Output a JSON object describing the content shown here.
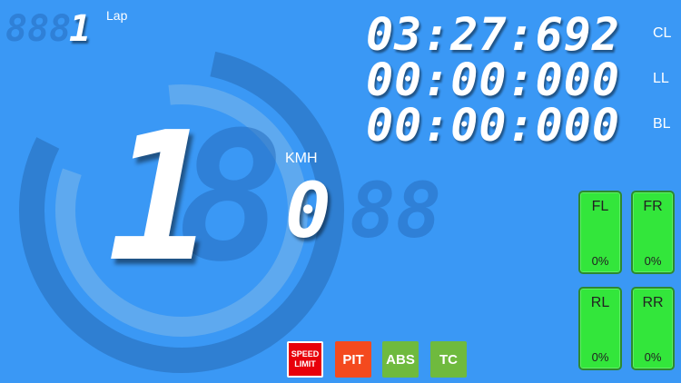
{
  "colors": {
    "background": "#3a98f5",
    "ring_dark": "#2f7fd2",
    "ring_light": "#5ea9ef",
    "tire_ok": "#33e63b",
    "speed_limit": "#e8000a",
    "pit": "#f44a1e",
    "assist": "#6fba3e"
  },
  "lap": {
    "number": "1",
    "label": "Lap",
    "ghost": "888"
  },
  "timers": [
    {
      "value": "03:27:692",
      "label": "CL"
    },
    {
      "value": "00:00:000",
      "label": "LL"
    },
    {
      "value": "00:00:000",
      "label": "BL"
    }
  ],
  "gear": {
    "value": "1",
    "ghost": "8"
  },
  "speed": {
    "unit": "KMH",
    "value": "0",
    "ghost": "88"
  },
  "tires": [
    {
      "name": "FL",
      "value": "0%"
    },
    {
      "name": "FR",
      "value": "0%"
    },
    {
      "name": "RL",
      "value": "0%"
    },
    {
      "name": "RR",
      "value": "0%"
    }
  ],
  "buttons": {
    "speed_limit": "SPEED LIMIT",
    "pit": "PIT",
    "abs": "ABS",
    "tc": "TC"
  }
}
